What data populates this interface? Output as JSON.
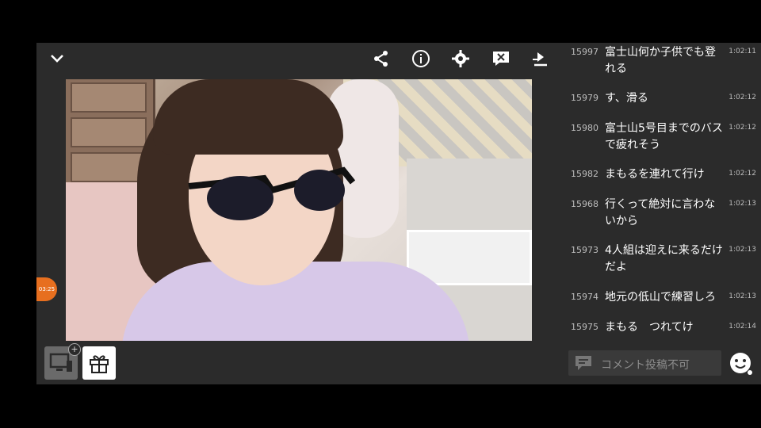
{
  "toolbar": {
    "icons": [
      "chevron-down-icon",
      "share-icon",
      "info-icon",
      "gear-icon",
      "close-comments-icon",
      "minimize-icon"
    ]
  },
  "video": {
    "timer_text": "03:25"
  },
  "comments": [
    {
      "num": "15997",
      "text": "富士山何か子供でも登れる",
      "time": "1:02:11"
    },
    {
      "num": "15979",
      "text": "す、滑る",
      "time": "1:02:12"
    },
    {
      "num": "15980",
      "text": "富士山5号目までのバスで疲れそう",
      "time": "1:02:12"
    },
    {
      "num": "15982",
      "text": "まもるを連れて行け",
      "time": "1:02:12"
    },
    {
      "num": "15968",
      "text": "行くって絶対に言わないから",
      "time": "1:02:13"
    },
    {
      "num": "15973",
      "text": "4人組は迎えに来るだけだよ",
      "time": "1:02:13"
    },
    {
      "num": "15974",
      "text": "地元の低山で練習しろ",
      "time": "1:02:13"
    },
    {
      "num": "15975",
      "text": "まもる　つれてけ",
      "time": "1:02:14"
    }
  ],
  "comment_input": {
    "placeholder": "コメント投稿不可"
  },
  "colors": {
    "background": "#2b2b2b",
    "timer_accent": "#e76f1f"
  }
}
